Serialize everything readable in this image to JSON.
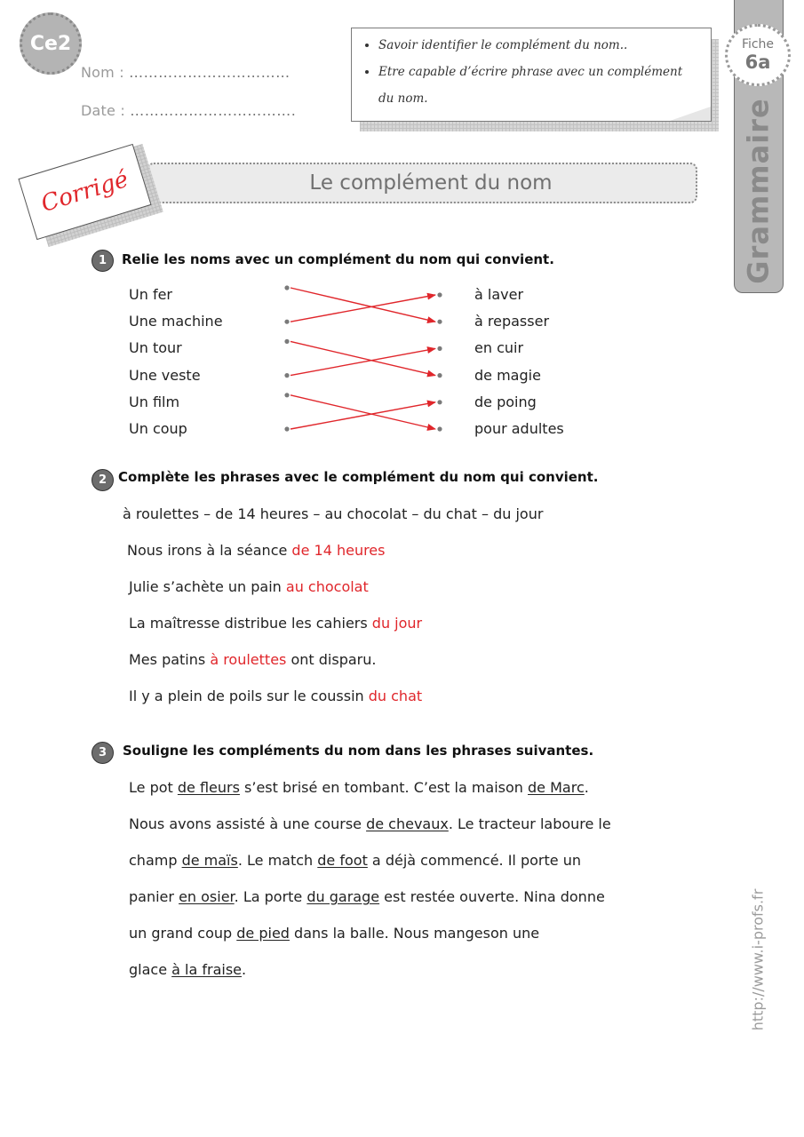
{
  "header": {
    "level": "Ce2",
    "name_label": "Nom :",
    "name_dots": "……………………………",
    "date_label": "Date :",
    "date_dots": "……………………………."
  },
  "objectives": [
    "Savoir identifier le complément du nom..",
    "Etre capable d’écrire phrase avec un complément du nom."
  ],
  "side_tab": {
    "fiche_label": "Fiche",
    "fiche_number": "6a",
    "subject": "Grammaire"
  },
  "corrige_label": "Corrigé",
  "page_title": "Le complément du nom",
  "exercise1": {
    "number": "1",
    "instruction": "Relie les noms avec un complément du nom qui convient.",
    "left": [
      "Un fer",
      "Une machine",
      "Un tour",
      "Une veste",
      "Un film",
      "Un coup"
    ],
    "right": [
      "à laver",
      "à repasser",
      "en cuir",
      "de magie",
      "de poing",
      "pour adultes"
    ],
    "links": [
      [
        0,
        1
      ],
      [
        1,
        0
      ],
      [
        2,
        3
      ],
      [
        3,
        2
      ],
      [
        4,
        5
      ],
      [
        5,
        4
      ]
    ],
    "link_color": "#e0262b"
  },
  "exercise2": {
    "number": "2",
    "instruction": "Complète les phrases avec le complément du nom qui convient.",
    "word_bank": "à roulettes – de 14 heures – au chocolat – du chat – du jour",
    "sentences": [
      {
        "before": "Nous irons à la séance ",
        "answer": "de 14 heures",
        "after": ""
      },
      {
        "before": "Julie s’achète un pain ",
        "answer": "au chocolat",
        "after": ""
      },
      {
        "before": "La maîtresse distribue les cahiers ",
        "answer": "du jour",
        "after": ""
      },
      {
        "before": "Mes patins ",
        "answer": "à roulettes",
        "after": " ont disparu."
      },
      {
        "before": "Il y a plein de poils sur le coussin ",
        "answer": "du chat",
        "after": ""
      }
    ]
  },
  "exercise3": {
    "number": "3",
    "instruction": "Souligne les compléments du nom dans les phrases suivantes.",
    "lines": [
      [
        {
          "t": "Le pot "
        },
        {
          "t": "de fleurs",
          "u": true
        },
        {
          "t": " s’est brisé en tombant. C’est la maison "
        },
        {
          "t": "de Marc",
          "u": true
        },
        {
          "t": "."
        }
      ],
      [
        {
          "t": "Nous avons assisté à une course "
        },
        {
          "t": "de chevaux",
          "u": true
        },
        {
          "t": ". Le tracteur laboure le"
        }
      ],
      [
        {
          "t": "champ "
        },
        {
          "t": "de maïs",
          "u": true
        },
        {
          "t": ".  Le match "
        },
        {
          "t": "de foot",
          "u": true
        },
        {
          "t": " a déjà commencé. Il porte un"
        }
      ],
      [
        {
          "t": "panier "
        },
        {
          "t": "en osier",
          "u": true
        },
        {
          "t": ". La porte "
        },
        {
          "t": "du garage",
          "u": true
        },
        {
          "t": " est restée ouverte. Nina donne"
        }
      ],
      [
        {
          "t": "un grand coup "
        },
        {
          "t": "de pied",
          "u": true
        },
        {
          "t": " dans la balle.  Nous mangeson une"
        }
      ],
      [
        {
          "t": "glace "
        },
        {
          "t": "à la fraise",
          "u": true
        },
        {
          "t": "."
        }
      ]
    ]
  },
  "footer_url": "http://www.i-profs.fr"
}
